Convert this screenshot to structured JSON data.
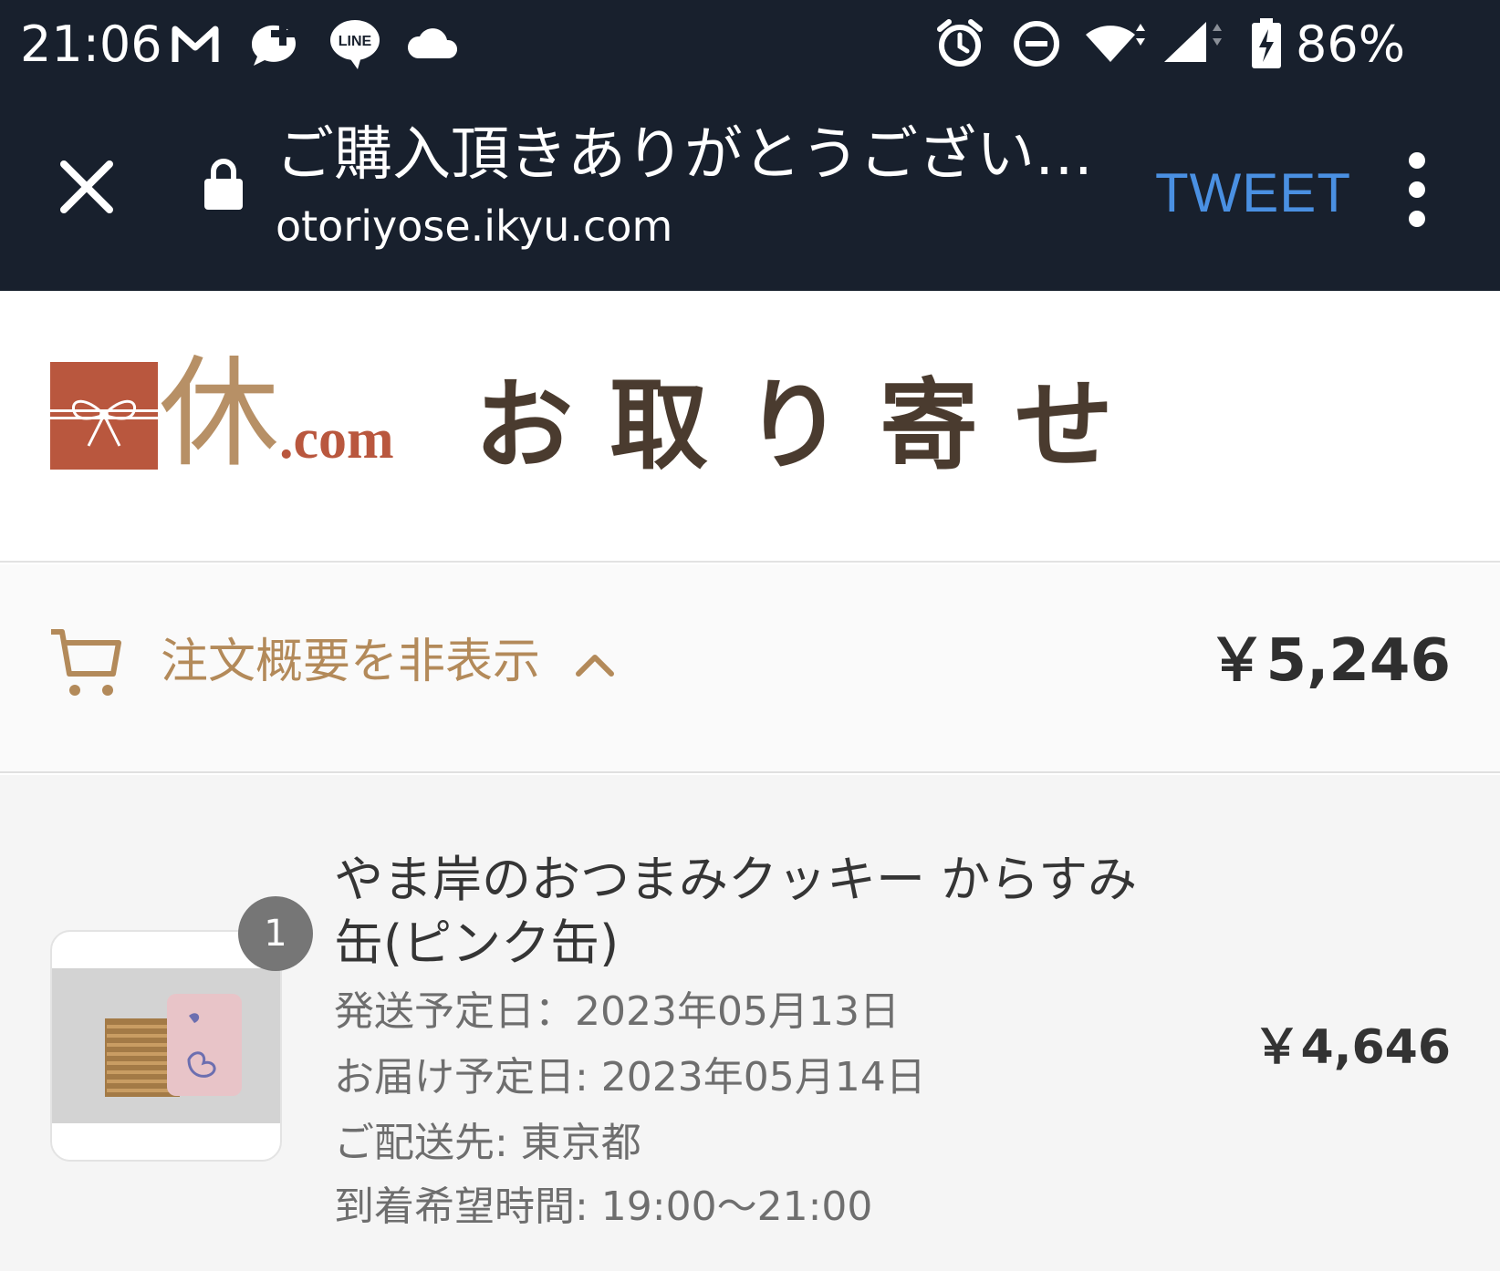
{
  "status_bar": {
    "time": "21:06",
    "battery": "86%",
    "icons": [
      "gmail-icon",
      "chat-plus-icon",
      "line-icon",
      "cloud-icon",
      "alarm-icon",
      "do-not-disturb-icon",
      "wifi-icon",
      "signal-icon",
      "battery-charging-icon"
    ],
    "line_label": "LINE"
  },
  "toolbar": {
    "title": "ご購入頂きありがとうござい…",
    "url": "otoriyose.ikyu.com",
    "tweet_label": "TWEET",
    "tweet_color": "#4a90e2"
  },
  "header": {
    "logo_kanji": "休",
    "logo_suffix": ".com",
    "site_name": "お取り寄せ",
    "brand_color": "#b9573e"
  },
  "summary": {
    "toggle_label": "注文概要を非表示",
    "total": "￥5,246",
    "accent_color": "#b38a5a"
  },
  "order": {
    "items": [
      {
        "quantity": "1",
        "name": "やま岸のおつまみクッキー からすみ缶(ピンク缶)",
        "ship_date": "発送予定日：2023年05月13日",
        "delivery_date": "お届け予定日: 2023年05月14日",
        "destination": "ご配送先: 東京都",
        "time_window": "到着希望時間: 19:00～21:00",
        "price": "￥4,646"
      }
    ]
  }
}
